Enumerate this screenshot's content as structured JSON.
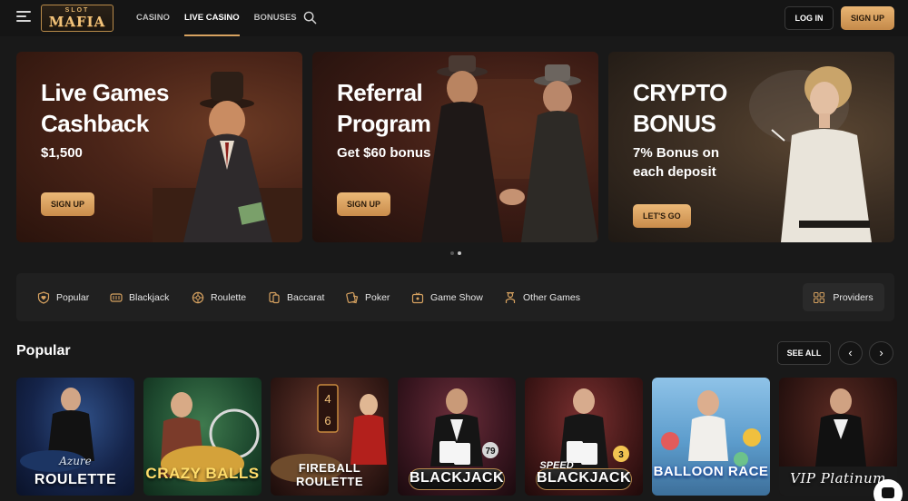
{
  "header": {
    "logo_small": "SLOT",
    "logo_big": "MAFIA",
    "nav": [
      "CASINO",
      "LIVE CASINO",
      "BONUSES"
    ],
    "active_nav": "LIVE CASINO",
    "login_label": "LOG IN",
    "signup_label": "SIGN UP"
  },
  "banners": [
    {
      "title_line1": "Live Games",
      "title_line2": "Cashback",
      "subtitle_line1": "$1,500",
      "subtitle_line2": "",
      "cta": "SIGN UP"
    },
    {
      "title_line1": "Referral",
      "title_line2": "Program",
      "subtitle_line1": "Get $60 bonus",
      "subtitle_line2": "",
      "cta": "SIGN UP"
    },
    {
      "title_line1": "CRYPTO",
      "title_line2": "BONUS",
      "subtitle_line1": "7% Bonus on",
      "subtitle_line2": "each deposit",
      "cta": "LET'S GO"
    }
  ],
  "carousel": {
    "pages": 2,
    "active_page": 2
  },
  "categories": [
    {
      "label": "Popular",
      "icon": "heart-shield-icon"
    },
    {
      "label": "Blackjack",
      "icon": "cards-icon"
    },
    {
      "label": "Roulette",
      "icon": "roulette-icon"
    },
    {
      "label": "Baccarat",
      "icon": "baccarat-icon"
    },
    {
      "label": "Poker",
      "icon": "poker-icon"
    },
    {
      "label": "Game Show",
      "icon": "tv-icon"
    },
    {
      "label": "Other Games",
      "icon": "dealer-icon"
    }
  ],
  "providers_label": "Providers",
  "popular": {
    "title": "Popular",
    "see_all": "SEE ALL",
    "games": [
      {
        "sub": "Azure",
        "title": "ROULETTE"
      },
      {
        "sub": "",
        "title": "CRAZY BALLS"
      },
      {
        "sub": "",
        "title": "FIREBALL ROULETTE"
      },
      {
        "sub": "",
        "title": "BLACKJACK"
      },
      {
        "sub": "SPEED",
        "title": "BLACKJACK"
      },
      {
        "sub": "",
        "title": "BALLOON RACE"
      },
      {
        "sub": "",
        "title": "VIP Platinum"
      }
    ]
  },
  "colors": {
    "accent": "#d7a260",
    "background": "#191919",
    "bar": "#202020"
  }
}
